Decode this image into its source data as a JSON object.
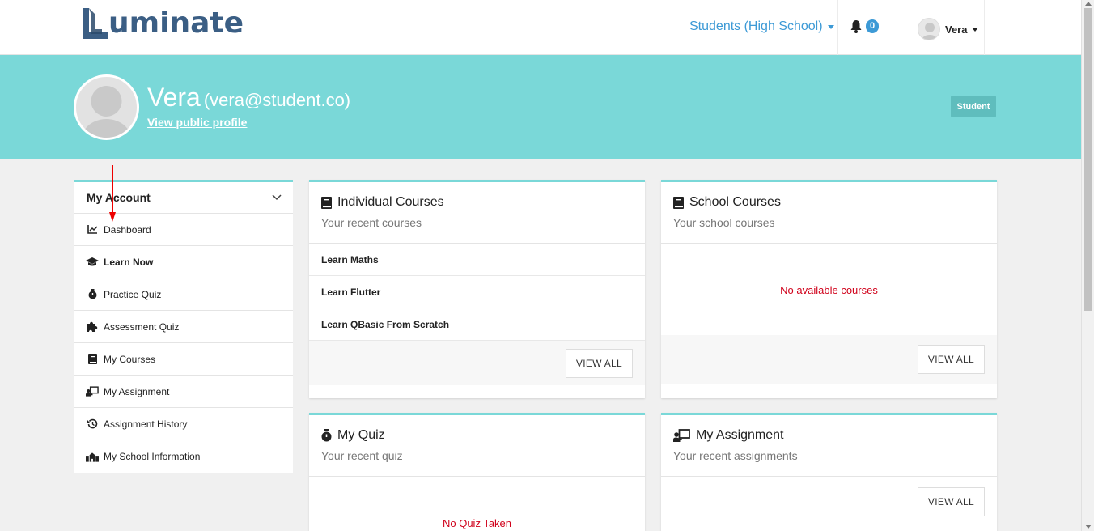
{
  "brand": {
    "name": "uminate"
  },
  "nav": {
    "role_selector": "Students (High School)",
    "notifications_count": "0",
    "user_name": "Vera"
  },
  "profile": {
    "name": "Vera",
    "email": "(vera@student.co)",
    "public_profile_link": "View public profile",
    "role_badge": "Student"
  },
  "sidebar": {
    "title": "My Account",
    "items": [
      {
        "label": "Dashboard",
        "icon": "chart-line-icon",
        "bold": false
      },
      {
        "label": "Learn Now",
        "icon": "graduation-cap-icon",
        "bold": true
      },
      {
        "label": "Practice Quiz",
        "icon": "stopwatch-icon",
        "bold": false
      },
      {
        "label": "Assessment Quiz",
        "icon": "puzzle-icon",
        "bold": false
      },
      {
        "label": "My Courses",
        "icon": "book-icon",
        "bold": false
      },
      {
        "label": "My Assignment",
        "icon": "chalkboard-teacher-icon",
        "bold": false
      },
      {
        "label": "Assignment History",
        "icon": "history-icon",
        "bold": false
      },
      {
        "label": "My School Information",
        "icon": "school-icon",
        "bold": false
      }
    ]
  },
  "cards": {
    "individual_courses": {
      "title": "Individual Courses",
      "subtitle": "Your recent courses",
      "rows": [
        "Learn Maths",
        "Learn Flutter",
        "Learn QBasic From Scratch"
      ],
      "button": "VIEW ALL"
    },
    "school_courses": {
      "title": "School Courses",
      "subtitle": "Your school courses",
      "empty": "No available courses",
      "button": "VIEW ALL"
    },
    "my_quiz": {
      "title": "My Quiz",
      "subtitle": "Your recent quiz",
      "empty": "No Quiz Taken"
    },
    "my_assignment": {
      "title": "My Assignment",
      "subtitle": "Your recent assignments",
      "button": "VIEW ALL"
    }
  },
  "colors": {
    "accent_teal": "#7ad8d8",
    "brand_blue": "#3b5e84",
    "link_blue": "#3d9ad6",
    "empty_red": "#d0021b"
  }
}
